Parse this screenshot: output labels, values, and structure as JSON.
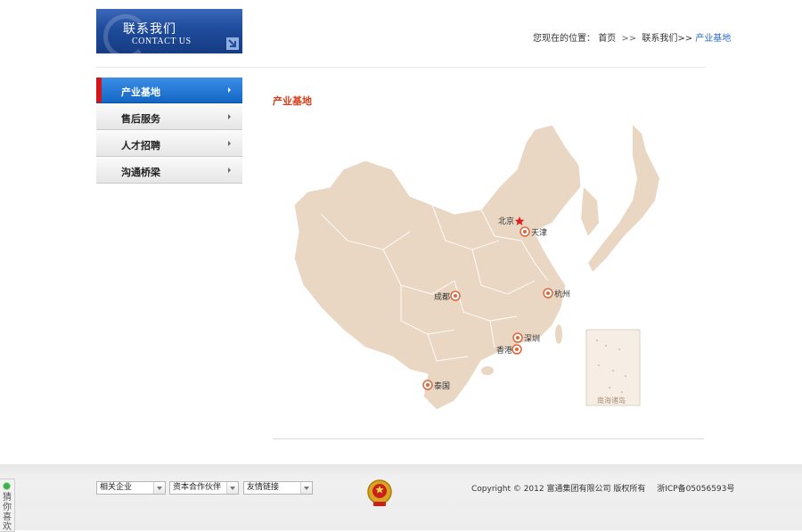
{
  "banner": {
    "title_cn": "联系我们",
    "title_en": "CONTACT US"
  },
  "breadcrumb": {
    "prefix": "您现在的位置：",
    "home": "首页",
    "sep1": ">>",
    "section": "联系我们",
    "sep2": ">>",
    "current": "产业基地"
  },
  "sidebar": {
    "items": [
      {
        "label": "产业基地",
        "active": true
      },
      {
        "label": "售后服务",
        "active": false
      },
      {
        "label": "人才招聘",
        "active": false
      },
      {
        "label": "沟通桥梁",
        "active": false
      }
    ]
  },
  "content": {
    "title": "产业基地",
    "map": {
      "capital": "北京",
      "inset_label": "南海诸岛",
      "bases": [
        "天津",
        "成都",
        "杭州",
        "深圳",
        "香港",
        "泰国"
      ]
    }
  },
  "footer": {
    "selects": [
      "相关企业",
      "资本合作伙伴",
      "友情链接"
    ],
    "copyright": "Copyright © 2012 富通集团有限公司 版权所有",
    "icp": "浙ICP备05056593号"
  },
  "float_tab": {
    "text": "猜你喜欢"
  },
  "colors": {
    "accent": "#d53f1a",
    "nav_active": "#1466c4",
    "map_fill": "#ead7c3",
    "marker": "#e0653a"
  }
}
